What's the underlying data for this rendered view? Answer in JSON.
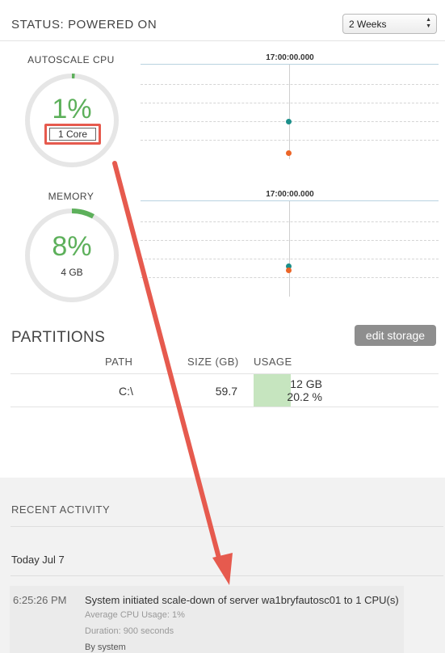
{
  "header": {
    "status": "STATUS: POWERED ON",
    "period_select": "2 Weeks"
  },
  "cpu": {
    "label": "AUTOSCALE CPU",
    "value": "1%",
    "sub": "1 Core",
    "percent": 1,
    "chart_time": "17:00:00.000"
  },
  "memory": {
    "label": "MEMORY",
    "value": "8%",
    "sub": "4 GB",
    "percent": 8,
    "chart_time": "17:00:00.000"
  },
  "partitions": {
    "title": "PARTITIONS",
    "edit_button": "edit storage",
    "columns": [
      "PATH",
      "SIZE (GB)",
      "USAGE"
    ],
    "rows": [
      {
        "path": "C:\\",
        "size": "59.7",
        "usage_gb": "12 GB",
        "usage_pct": "20.2 %"
      }
    ]
  },
  "activity": {
    "title": "RECENT ACTIVITY",
    "date": "Today Jul 7",
    "items": [
      {
        "time": "6:25:26 PM",
        "message": "System initiated scale-down of server wa1bryfautosc01 to 1 CPU(s)",
        "avg_cpu": "Average CPU Usage: 1%",
        "duration": "Duration: 900 seconds",
        "by": "By system"
      }
    ]
  },
  "colors": {
    "gauge_fill": "#5db05b",
    "gauge_track": "#e6e6e6",
    "dot_teal": "#1b8f8a",
    "dot_orange": "#ec6527",
    "annotation": "#e65a4e"
  }
}
